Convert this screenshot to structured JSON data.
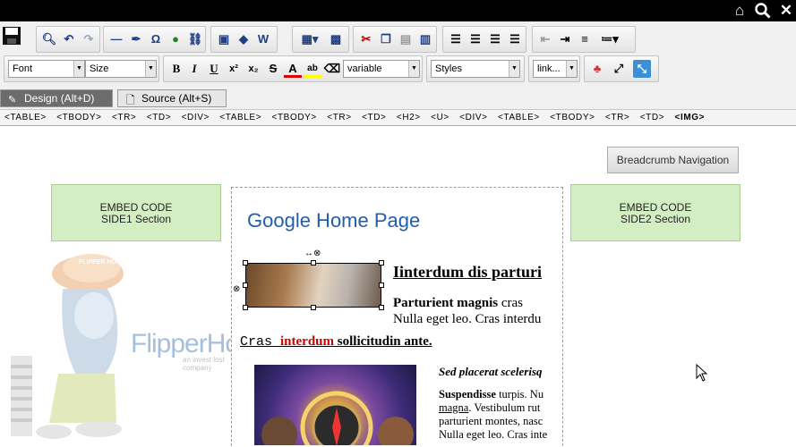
{
  "toolbar": {
    "font_select": "Font",
    "size_select": "Size",
    "variable_select": "variable",
    "styles_select": "Styles",
    "link_select": "link..."
  },
  "tabs": {
    "design": "Design (Alt+D)",
    "source": "Source (Alt+S)"
  },
  "breadcrumb": [
    "<TABLE>",
    "<TBODY>",
    "<TR>",
    "<TD>",
    "<DIV>",
    "<TABLE>",
    "<TBODY>",
    "<TR>",
    "<TD>",
    "<H2>",
    "<U>",
    "<DIV>",
    "<TABLE>",
    "<TBODY>",
    "<TR>",
    "<TD>",
    "<IMG>"
  ],
  "stage": {
    "breadcrumb_button": "Breadcrumb Navigation",
    "side1": {
      "line1": "EMBED CODE",
      "line2": "SIDE1 Section"
    },
    "side2": {
      "line1": "EMBED CODE",
      "line2": "SIDE2 Section"
    },
    "logo_text": "FlipperHost",
    "logo_tag": "an invest lost company",
    "mascot_cap": "FLIPPER HOST"
  },
  "document": {
    "title": "Google Home Page",
    "heading": "Iinterdum dis parturi",
    "para_bold": "Parturient magnis",
    "para_rest": " cras",
    "para_line2": "Nulla eget leo. Cras interdu",
    "underline_a": "Cras ",
    "underline_red": "interdum",
    "underline_b": " sollicitudin ante.",
    "italic_heading": "Sed placerat scelerisq",
    "p2_bold": "Suspendisse",
    "p2_rest": " turpis. Nu",
    "p2_line2_u": "magna",
    "p2_line2_rest": ". Vestibulum rut",
    "p2_line3": "parturient montes, nasc",
    "p2_line4": "Nulla eget leo. Cras inte"
  },
  "colors": {
    "accent_title": "#1f5fad",
    "red_text": "#d00000",
    "embed_bg": "#d4eec4"
  }
}
